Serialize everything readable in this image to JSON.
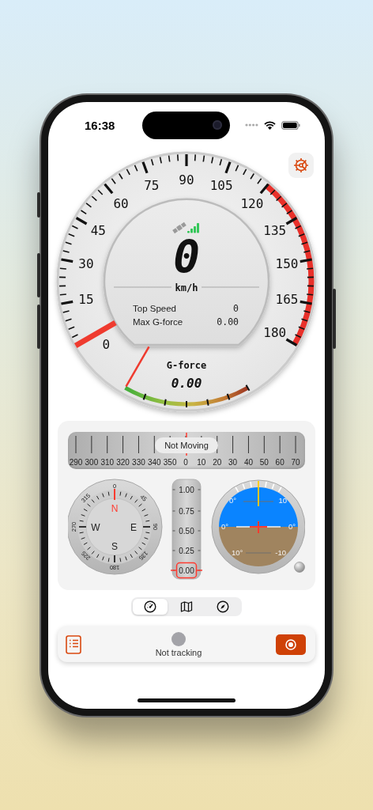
{
  "status_bar": {
    "time": "16:38"
  },
  "speedometer": {
    "scale_labels": [
      "0",
      "15",
      "30",
      "45",
      "60",
      "75",
      "90",
      "105",
      "120",
      "135",
      "150",
      "165",
      "180"
    ],
    "speed": "0",
    "unit": "km/h",
    "stats": [
      {
        "label": "Top Speed",
        "value": "0"
      },
      {
        "label": "Max G-force",
        "value": "0.00"
      }
    ],
    "gforce": {
      "label": "G-force",
      "value": "0.00"
    }
  },
  "instruments": {
    "heading_tape": {
      "labels": [
        "290",
        "300",
        "310",
        "320",
        "330",
        "340",
        "350",
        "0",
        "10",
        "20",
        "30",
        "40",
        "50",
        "60",
        "70"
      ],
      "status": "Not Moving"
    },
    "compass": {
      "degree_labels": [
        "0",
        "45",
        "90",
        "135",
        "180",
        "225",
        "270",
        "315"
      ],
      "cardinals": [
        "N",
        "E",
        "S",
        "W"
      ]
    },
    "g_meter": {
      "labels": [
        "1.00",
        "0.75",
        "0.50",
        "0.25",
        "0.00"
      ]
    },
    "attitude": {
      "labels": [
        "0°",
        "10",
        "0°",
        "0°",
        "10°",
        "-10"
      ]
    }
  },
  "view_tabs": [
    {
      "kind": "speedometer",
      "selected": true
    },
    {
      "kind": "map",
      "selected": false
    },
    {
      "kind": "compass",
      "selected": false
    }
  ],
  "tracking": {
    "status": "Not tracking",
    "on": false
  }
}
